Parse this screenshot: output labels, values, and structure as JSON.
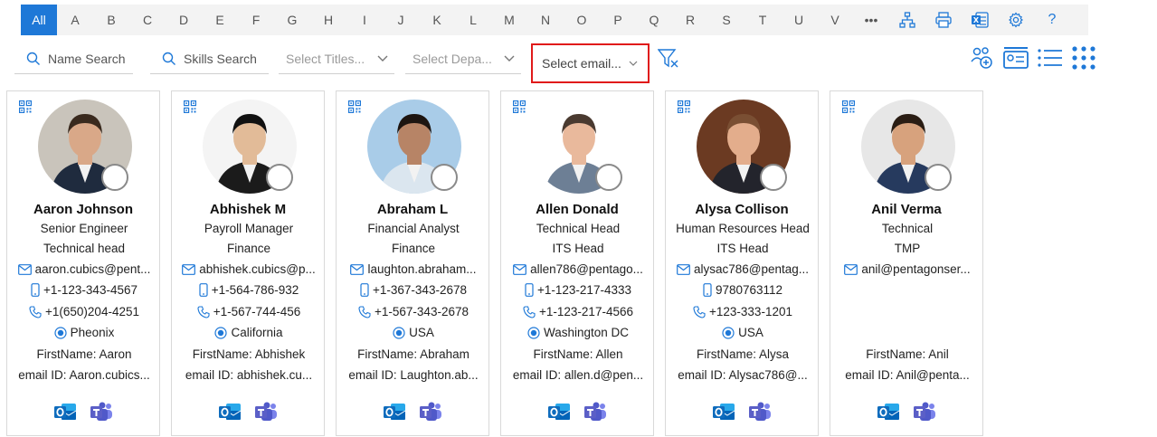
{
  "alphabet": {
    "letters": [
      "All",
      "A",
      "B",
      "C",
      "D",
      "E",
      "F",
      "G",
      "H",
      "I",
      "J",
      "K",
      "L",
      "M",
      "N",
      "O",
      "P",
      "Q",
      "R",
      "S",
      "T",
      "U",
      "V"
    ],
    "more_label": "•••",
    "tools": [
      "org-chart-icon",
      "print-icon",
      "excel-export-icon",
      "settings-icon",
      "help-icon"
    ],
    "help_label": "?"
  },
  "filters": {
    "name_search": "Name Search",
    "skills_search": "Skills Search",
    "titles_placeholder": "Select Titles...",
    "departments_placeholder": "Select Depa...",
    "email_placeholder": "Select email..."
  },
  "colors": {
    "accent": "#1e78d7",
    "highlight_border": "#e01a1a",
    "outlook": "#0f6cbd",
    "teams": "#5b5fc7"
  },
  "cards": [
    {
      "name": "Aaron Johnson",
      "title": "Senior Engineer",
      "dept": "Technical head",
      "email": "aaron.cubics@pent...",
      "phone1": "+1-123-343-4567",
      "phone2": "+1(650)204-4251",
      "location": "Pheonix",
      "first": "FirstName: Aaron",
      "emailid": "email ID: Aaron.cubics...",
      "photo_bg": "#c9c4bb",
      "skin": "#d9a888",
      "hair": "#3a2a1e",
      "suit": "#1f2b3e"
    },
    {
      "name": "Abhishek M",
      "title": "Payroll Manager",
      "dept": "Finance",
      "email": "abhishek.cubics@p...",
      "phone1": "+1-564-786-932",
      "phone2": "+1-567-744-456",
      "location": "California",
      "first": "FirstName: Abhishek",
      "emailid": "email ID: abhishek.cu...",
      "photo_bg": "#f4f4f4",
      "skin": "#e2bb98",
      "hair": "#111111",
      "suit": "#1b1b1b"
    },
    {
      "name": "Abraham L",
      "title": "Financial Analyst",
      "dept": "Finance",
      "email": "laughton.abraham...",
      "phone1": "+1-367-343-2678",
      "phone2": "+1-567-343-2678",
      "location": "USA",
      "first": "FirstName: Abraham",
      "emailid": "email ID: Laughton.ab...",
      "photo_bg": "#a9cce8",
      "skin": "#b78466",
      "hair": "#1d1511",
      "suit": "#dbe6ef"
    },
    {
      "name": "Allen Donald",
      "title": "Technical Head",
      "dept": "ITS Head",
      "email": "allen786@pentago...",
      "phone1": "+1-123-217-4333",
      "phone2": "+1-123-217-4566",
      "location": "Washington DC",
      "first": "FirstName: Allen",
      "emailid": "email ID: allen.d@pen...",
      "photo_bg": "#ffffff",
      "skin": "#e9b99c",
      "hair": "#4a3a30",
      "suit": "#6d7f95"
    },
    {
      "name": "Alysa Collison",
      "title": "Human Resources Head",
      "dept": "ITS Head",
      "email": "alysac786@pentag...",
      "phone1": "9780763112",
      "phone2": "+123-333-1201",
      "location": "USA",
      "first": "FirstName: Alysa",
      "emailid": "email ID: Alysac786@...",
      "photo_bg": "#6b3a22",
      "skin": "#e3ad8c",
      "hair": "#7a4f33",
      "suit": "#23242c"
    },
    {
      "name": "Anil Verma",
      "title": "Technical",
      "dept": "TMP",
      "email": "anil@pentagonser...",
      "phone1": "",
      "phone2": "",
      "location": "",
      "first": "FirstName: Anil",
      "emailid": "email ID: Anil@penta...",
      "photo_bg": "#e7e7e7",
      "skin": "#d7a27d",
      "hair": "#2a1d14",
      "suit": "#263a5e"
    }
  ]
}
